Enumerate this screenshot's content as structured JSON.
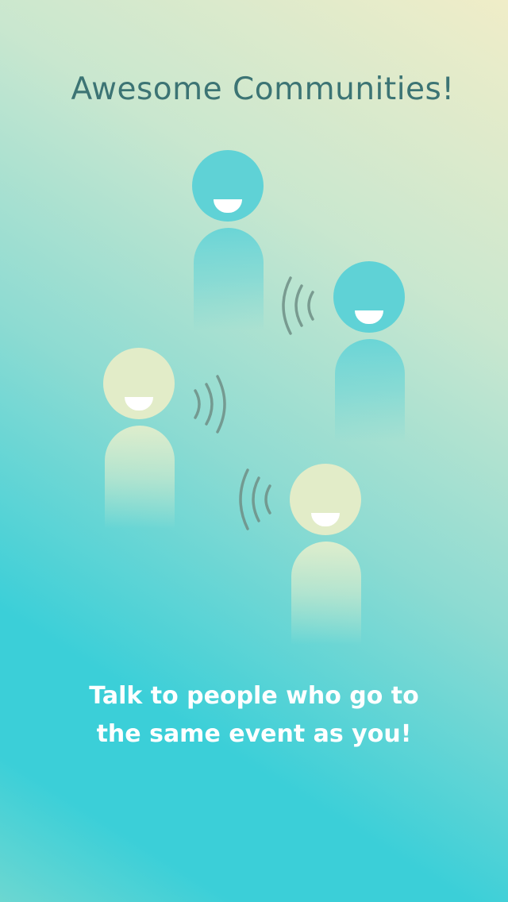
{
  "onboarding": {
    "title": "Awesome Communities!",
    "caption_line1": "Talk to people who go to",
    "caption_line2": "the same event as you!"
  },
  "illustration": {
    "people": [
      {
        "name": "person-top",
        "head_color": "#5fd2d6"
      },
      {
        "name": "person-right",
        "head_color": "#5fd2d6"
      },
      {
        "name": "person-left",
        "head_color": "#e2ecc8"
      },
      {
        "name": "person-bottom",
        "head_color": "#e2ecc8"
      }
    ],
    "wave_color": "#6f8f86",
    "icons": [
      "smiley-person-icon",
      "sound-waves-icon"
    ]
  },
  "colors": {
    "gradient_top": "#f0edc8",
    "gradient_bottom": "#3bcfd8",
    "title_color": "#3c7474",
    "caption_color": "#ffffff"
  }
}
